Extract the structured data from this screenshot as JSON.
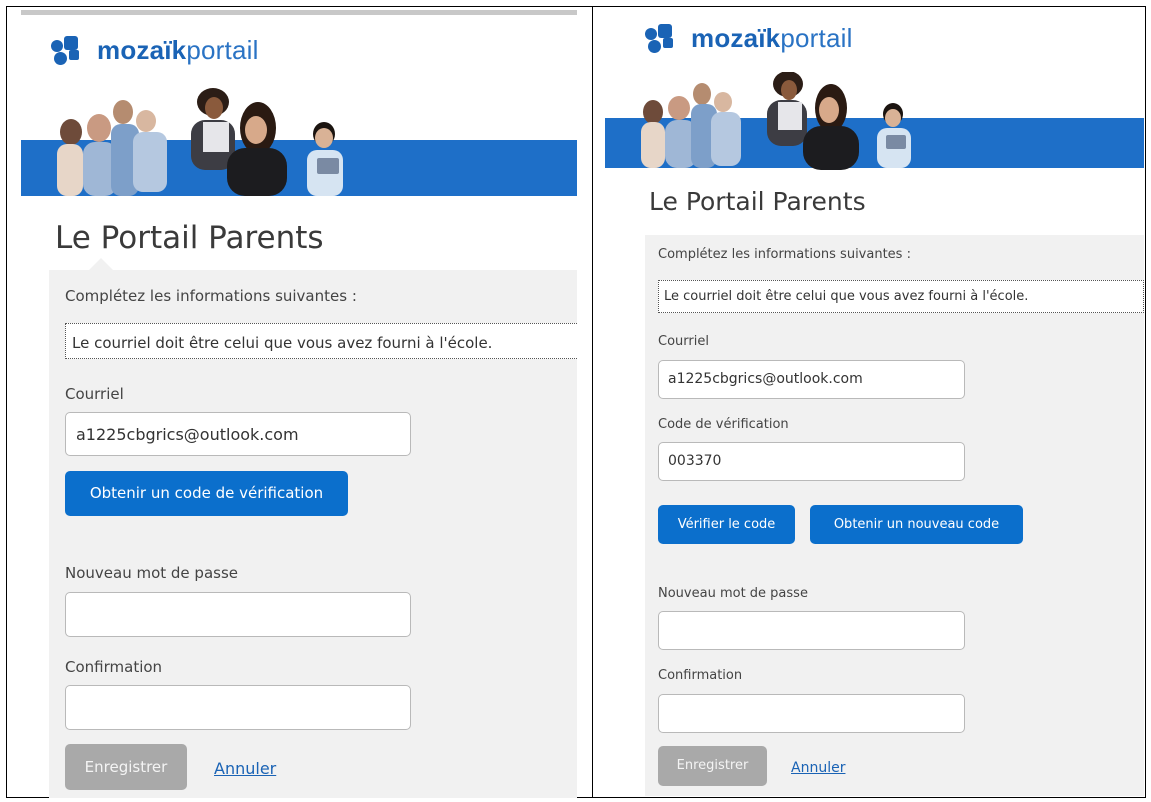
{
  "left_panel": {
    "logo": {
      "brand_bold": "mozaïk",
      "brand_thin": "portail"
    },
    "page_title": "Le Portail Parents",
    "instructions": "Complétez les informations suivantes :",
    "info_message": "Le courriel doit être celui que vous avez fourni à l'école.",
    "email_label": "Courriel",
    "email_value": "a1225cbgrics@outlook.com",
    "get_code_button": "Obtenir un code de vérification",
    "new_password_label": "Nouveau mot de passe",
    "new_password_value": "",
    "confirmation_label": "Confirmation",
    "confirmation_value": "",
    "save_button": "Enregistrer",
    "cancel_link": "Annuler"
  },
  "right_panel": {
    "logo": {
      "brand_bold": "mozaïk",
      "brand_thin": "portail"
    },
    "page_title": "Le Portail Parents",
    "instructions": "Complétez les informations suivantes :",
    "info_message": "Le courriel doit être celui que vous avez fourni à l'école.",
    "email_label": "Courriel",
    "email_value": "a1225cbgrics@outlook.com",
    "code_label": "Code de vérification",
    "code_value": "003370",
    "verify_button": "Vérifier le code",
    "new_code_button": "Obtenir un nouveau code",
    "new_password_label": "Nouveau mot de passe",
    "new_password_value": "",
    "confirmation_label": "Confirmation",
    "confirmation_value": "",
    "save_button": "Enregistrer",
    "cancel_link": "Annuler"
  },
  "colors": {
    "brand_blue": "#1a63b5",
    "button_blue": "#0b6fcc",
    "banner_blue": "#1e6fc8",
    "form_background": "#f1f1f1",
    "disabled_button": "#a9a9a9"
  }
}
